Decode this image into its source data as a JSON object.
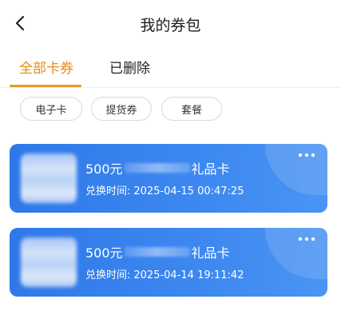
{
  "header": {
    "title": "我的券包",
    "back_icon": "chevron-left-icon"
  },
  "tabs": [
    {
      "label": "全部卡券",
      "active": true
    },
    {
      "label": "已删除",
      "active": false
    }
  ],
  "filters": [
    {
      "label": "电子卡"
    },
    {
      "label": "提货券"
    },
    {
      "label": "套餐"
    }
  ],
  "cards": [
    {
      "amount": "500元",
      "suffix": "礼品卡",
      "time_label": "兑换时间:",
      "time_value": "2025-04-15 00:47:25",
      "more_icon": "more-dots-icon"
    },
    {
      "amount": "500元",
      "suffix": "礼品卡",
      "time_label": "兑换时间:",
      "time_value": "2025-04-14 19:11:42",
      "more_icon": "more-dots-icon"
    }
  ],
  "colors": {
    "accent": "#e58a13",
    "card_blue": "#2f78e9",
    "chip_border": "#d9d9d9"
  }
}
